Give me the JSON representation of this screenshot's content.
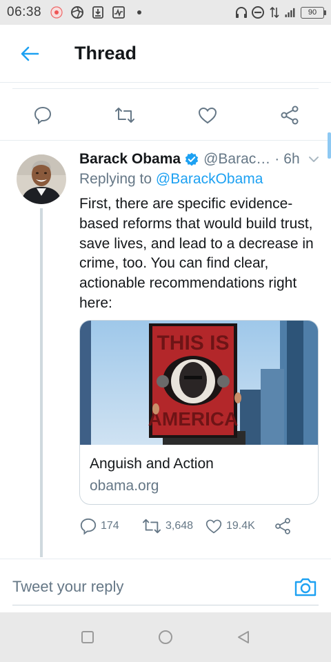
{
  "status_bar": {
    "time": "06:38",
    "battery_level": "90",
    "icons_left": [
      "notification-icon",
      "aperture-icon",
      "download-icon",
      "activity-icon",
      "dot-icon"
    ],
    "icons_right": [
      "headphones-icon",
      "minus-circle-icon",
      "data-arrows-icon",
      "signal-icon",
      "battery-icon"
    ]
  },
  "header": {
    "title": "Thread"
  },
  "tweet": {
    "author_name": "Barack Obama",
    "handle": "@Barac…",
    "separator": "·",
    "time": "6h",
    "replying_prefix": "Replying to",
    "replying_to": "@BarackObama",
    "text": "First, there are specific evidence-based reforms that would build trust, save lives, and lead to a decrease in crime, too. You can find clear, actionable recommendations right here:",
    "card": {
      "image_text_line1": "THIS IS",
      "image_text_line2": "AMERICA",
      "title": "Anguish and Action",
      "domain": "obama.org"
    },
    "actions": {
      "replies": "174",
      "retweets": "3,648",
      "likes": "19.4K"
    }
  },
  "reply": {
    "placeholder": "Tweet your reply"
  },
  "colors": {
    "accent": "#1da1f2",
    "secondary_text": "#657786",
    "border": "#e6ecf0"
  }
}
